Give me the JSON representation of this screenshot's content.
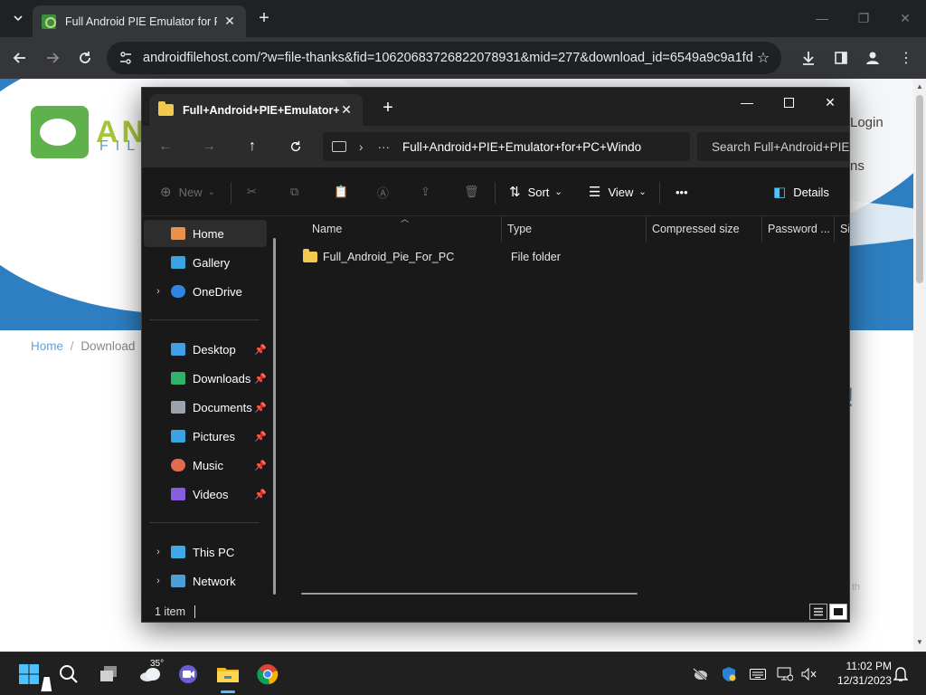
{
  "browser": {
    "tab_title": "Full Android PIE Emulator for PC",
    "url": "androidfilehost.com/?w=file-thanks&fid=10620683726822078931&mid=277&download_id=6549a9c9a1fd..."
  },
  "website": {
    "logo_text": "AN",
    "logo_sub": "FIL",
    "login": "Login",
    "partial_right": "ns",
    "breadcrumb": {
      "home": "Home",
      "current": "Download"
    },
    "partial_bang": "!",
    "partial_footer": "th"
  },
  "explorer": {
    "tab_title": "Full+Android+PIE+Emulator+f",
    "path": "Full+Android+PIE+Emulator+for+PC+Windo",
    "search_placeholder": "Search Full+Android+PIE",
    "commands": {
      "new": "New",
      "sort": "Sort",
      "view": "View",
      "more": "•••",
      "details": "Details"
    },
    "nav": {
      "home": "Home",
      "gallery": "Gallery",
      "onedrive": "OneDrive",
      "desktop": "Desktop",
      "downloads": "Downloads",
      "documents": "Documents",
      "pictures": "Pictures",
      "music": "Music",
      "videos": "Videos",
      "this_pc": "This PC",
      "network": "Network"
    },
    "columns": {
      "name": "Name",
      "type": "Type",
      "compressed_size": "Compressed size",
      "password": "Password ...",
      "size": "Si"
    },
    "files": [
      {
        "name": "Full_Android_Pie_For_PC",
        "type": "File folder"
      }
    ],
    "status": "1 item"
  },
  "taskbar": {
    "weather_temp": "35°",
    "time": "11:02 PM",
    "date": "12/31/2023"
  },
  "colors": {
    "accent": "#4cc2ff",
    "folder": "#f2c94c",
    "site_blue": "#2d7fc1"
  }
}
